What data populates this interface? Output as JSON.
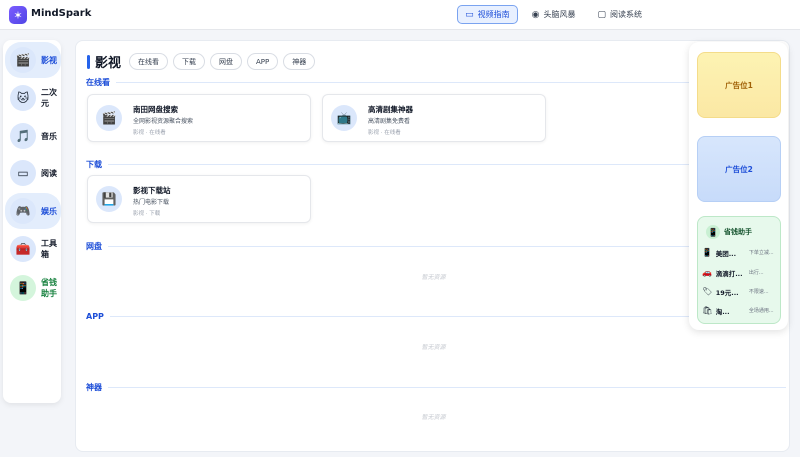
{
  "brand": {
    "logo_glyph": "✶",
    "name": "MindSpark"
  },
  "topnav": [
    {
      "label": "视频指南",
      "icon": "▭",
      "active": true
    },
    {
      "label": "头脑风暴",
      "icon": "◉",
      "active": false
    },
    {
      "label": "阅读系统",
      "icon": "▢",
      "active": false
    }
  ],
  "sidebar": [
    {
      "label": "影视",
      "icon": "🎬",
      "active": true
    },
    {
      "label": "二次\n元",
      "icon": "🐱"
    },
    {
      "label": "音乐",
      "icon": "🎵"
    },
    {
      "label": "阅读",
      "icon": "▭"
    },
    {
      "label": "娱乐",
      "icon": "🎮",
      "active": true
    },
    {
      "label": "工具\n箱",
      "icon": "🧰"
    },
    {
      "label": "省钱\n助手",
      "icon": "📱",
      "green": true
    }
  ],
  "main": {
    "title": "影视",
    "tabs": [
      "在线看",
      "下载",
      "网盘",
      "APP",
      "神器"
    ],
    "sections": {
      "online": {
        "title": "在线看"
      },
      "download": {
        "title": "下载"
      },
      "netdisk": {
        "title": "网盘",
        "empty": "暂无资源"
      },
      "app": {
        "title": "APP",
        "empty": "暂无资源"
      },
      "tool": {
        "title": "神器",
        "empty": "暂无资源"
      }
    },
    "cards": {
      "c1": {
        "name": "南田网盘搜索",
        "desc": "全网影视资源聚合搜索",
        "tags": "影视 · 在线看",
        "icon": "🎬"
      },
      "c2": {
        "name": "高清剧集神器",
        "desc": "高清剧集免费看",
        "tags": "影视 · 在线看",
        "icon": "📺"
      },
      "c3": {
        "name": "影视下载站",
        "desc": "热门电影下载",
        "tags": "影视 · 下载",
        "icon": "💾"
      }
    }
  },
  "ads": {
    "ad1": "广告位1",
    "ad2": "广告位2",
    "saver": {
      "title": "省钱助手",
      "icon": "📱",
      "items": [
        {
          "icon": "📱",
          "name": "美团...",
          "desc": "下单立减..."
        },
        {
          "icon": "🚗",
          "name": "滴滴打...",
          "desc": "出行..."
        },
        {
          "icon": "🏷",
          "name": "19元...",
          "desc": "不限速..."
        },
        {
          "icon": "🛍",
          "name": "淘...",
          "desc": "全场通用..."
        }
      ]
    }
  }
}
